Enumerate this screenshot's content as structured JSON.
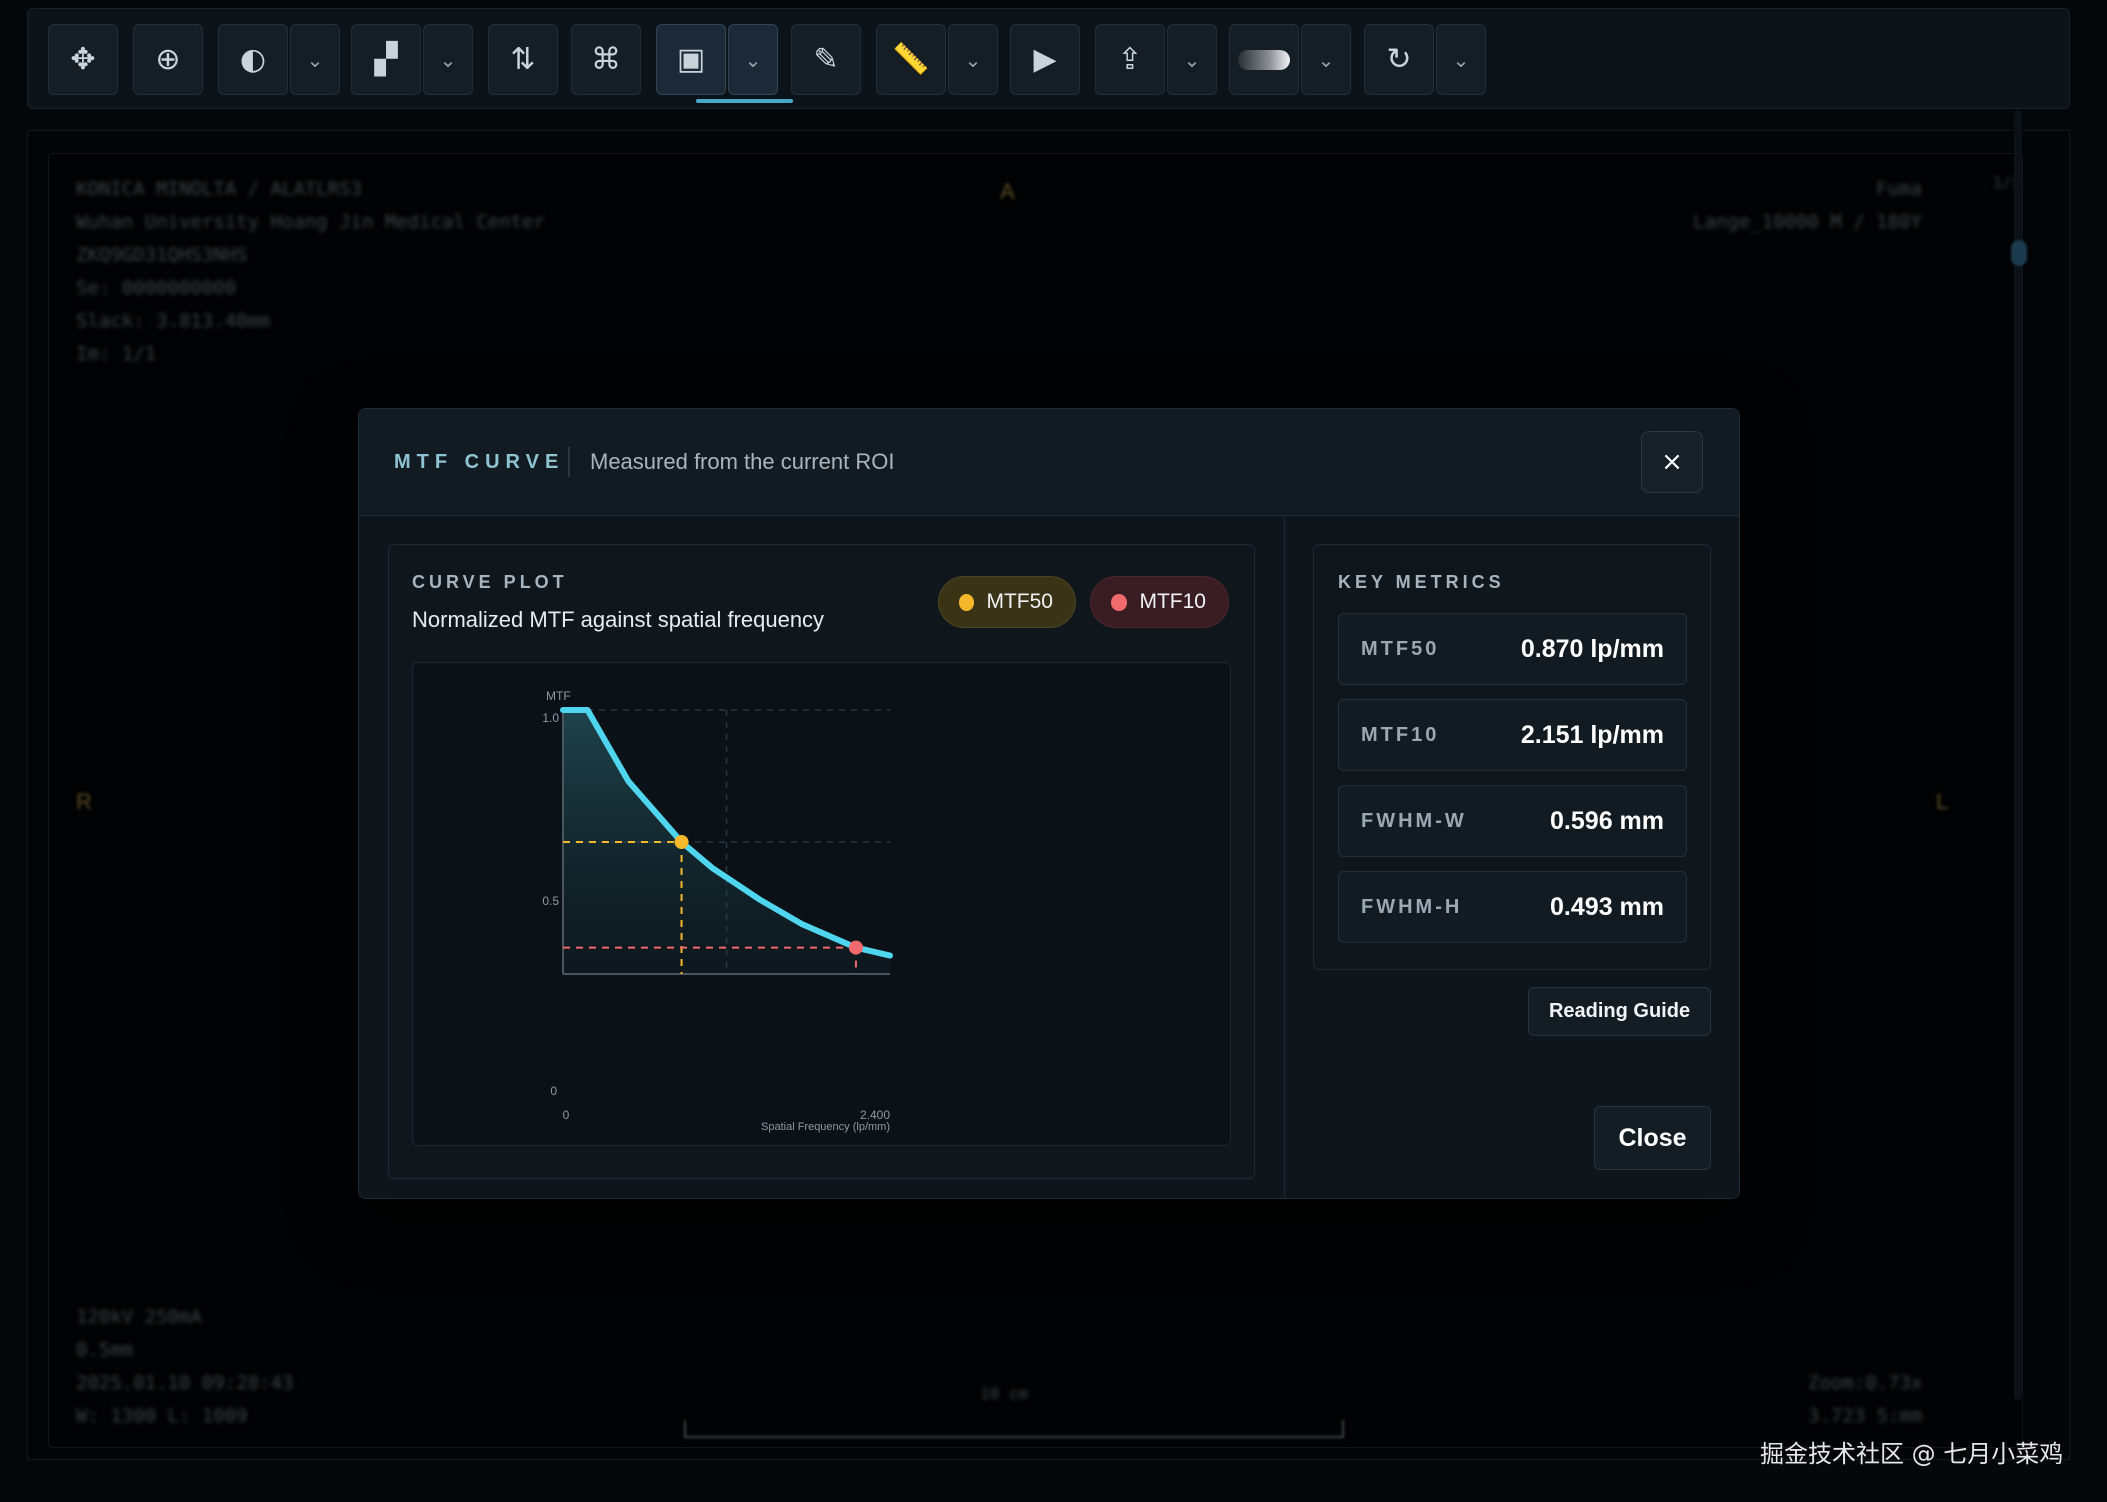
{
  "toolbar": {
    "buttons": [
      {
        "name": "pan-button",
        "icon": "move-icon",
        "glyph": "✥",
        "dropdown": false
      },
      {
        "name": "zoom-button",
        "icon": "zoom-in-icon",
        "glyph": "⊕",
        "dropdown": false
      },
      {
        "name": "window-level-button",
        "icon": "contrast-icon",
        "glyph": "◐",
        "dropdown": true
      },
      {
        "name": "layout-button",
        "icon": "layout-icon",
        "glyph": "▞",
        "dropdown": true
      },
      {
        "name": "scroll-button",
        "icon": "sort-arrows-icon",
        "glyph": "⇅",
        "dropdown": false
      },
      {
        "name": "tag-button",
        "icon": "tag-icon",
        "glyph": "⌘",
        "dropdown": false
      },
      {
        "name": "mtf-button",
        "icon": "chart-icon",
        "glyph": "▣",
        "dropdown": true,
        "active": true
      },
      {
        "name": "annotate-button",
        "icon": "pencil-icon",
        "glyph": "✎",
        "dropdown": false
      },
      {
        "name": "measure-button",
        "icon": "ruler-icon",
        "glyph": "📏",
        "dropdown": true
      },
      {
        "name": "cine-button",
        "icon": "play-icon",
        "glyph": "▶",
        "dropdown": false
      },
      {
        "name": "export-button",
        "icon": "share-icon",
        "glyph": "⇪",
        "dropdown": true
      },
      {
        "name": "invert-button",
        "icon": "gradient-toggle-icon",
        "glyph": "",
        "dropdown": true
      },
      {
        "name": "reset-button",
        "icon": "refresh-icon",
        "glyph": "↻",
        "dropdown": true
      }
    ],
    "dropdown_glyph": "⌄"
  },
  "viewport": {
    "top_left": "KONICA MINOLTA / ALATLRS3\nWuhan University Hoang Jin Medical Center\nZKQ9GD31QHS3NHS\nSe: 0000000000\nSlack: 3.813.40mm\nIm: 1/1",
    "top_right": "Fuma\nLange_10000 M / 180Y",
    "bottom_left": "120kV 250mA\n0.5mm\n2025.01.10 09:28:43\nW: 1300 L: 1009",
    "bottom_right": "Zoom:0.73x\n3.723 5:mm",
    "ruler_label": "10 cm",
    "orient_left": "R",
    "orient_right": "L",
    "orient_top": "A",
    "scroll_label": "1/1"
  },
  "modal": {
    "title": "MTF CURVE",
    "subtitle": "Measured from the current ROI",
    "close_icon": "×",
    "curve_panel": {
      "label": "CURVE PLOT",
      "description": "Normalized MTF against spatial frequency",
      "chips": [
        {
          "label": "MTF50",
          "color": "#f5b82a"
        },
        {
          "label": "MTF10",
          "color": "#f06a6e"
        }
      ]
    },
    "metrics_panel": {
      "label": "KEY METRICS",
      "items": [
        {
          "label": "MTF50",
          "value": "0.870 lp/mm"
        },
        {
          "label": "MTF10",
          "value": "2.151 lp/mm"
        },
        {
          "label": "FWHM-W",
          "value": "0.596 mm"
        },
        {
          "label": "FWHM-H",
          "value": "0.493 mm"
        }
      ]
    },
    "reading_guide_label": "Reading Guide",
    "close_label": "Close"
  },
  "chart_data": {
    "type": "line",
    "ylabel": "MTF",
    "xlabel": "Spatial Frequency (lp/mm)",
    "xlim": [
      0,
      2.4
    ],
    "ylim": [
      0,
      1.0
    ],
    "x_tick_labels": [
      "0",
      "2.400"
    ],
    "y_tick_labels": [
      "0",
      "0.5",
      "1.0"
    ],
    "series": [
      {
        "color": "#4fd6ee",
        "x": [
          0.0,
          0.18,
          0.48,
          0.87,
          1.1,
          1.45,
          1.75,
          2.15,
          2.4
        ],
        "y": [
          1.0,
          1.0,
          0.73,
          0.5,
          0.4,
          0.28,
          0.19,
          0.1,
          0.07
        ]
      }
    ],
    "markers": [
      {
        "label": "MTF50",
        "x": 0.87,
        "y": 0.5,
        "color": "#f5b82a"
      },
      {
        "label": "MTF10",
        "x": 2.15,
        "y": 0.1,
        "color": "#f06a6e"
      }
    ],
    "grid": true
  },
  "watermark": "掘金技术社区 @ 七月小菜鸡"
}
